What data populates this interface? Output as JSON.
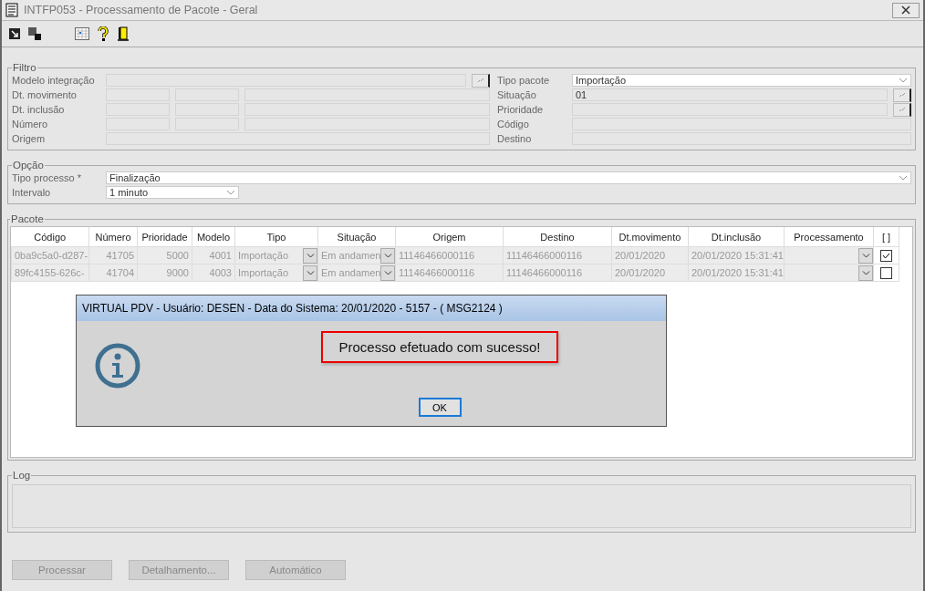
{
  "window": {
    "title": "INTFP053 - Processamento de Pacote - Geral"
  },
  "filtro": {
    "title": "Filtro",
    "left": [
      {
        "label": "Modelo integração",
        "kind": "lookup"
      },
      {
        "label": "Dt. movimento",
        "kind": "range"
      },
      {
        "label": "Dt. inclusão",
        "kind": "range"
      },
      {
        "label": "Número",
        "kind": "range"
      },
      {
        "label": "Origem",
        "kind": "text"
      }
    ],
    "right": [
      {
        "label": "Tipo pacote",
        "kind": "select",
        "value": "Importação"
      },
      {
        "label": "Situação",
        "kind": "lookup",
        "value": "01"
      },
      {
        "label": "Prioridade",
        "kind": "lookup"
      },
      {
        "label": "Código",
        "kind": "text"
      },
      {
        "label": "Destino",
        "kind": "text"
      }
    ]
  },
  "opcao": {
    "title": "Opção",
    "fields": [
      {
        "label": "Tipo processo *",
        "kind": "wide",
        "value": "Finalização"
      },
      {
        "label": "Intervalo",
        "kind": "short",
        "value": "1 minuto"
      }
    ]
  },
  "pacote": {
    "title": "Pacote",
    "columns": [
      "Código",
      "Número",
      "Prioridade",
      "Modelo",
      "Tipo",
      "Situação",
      "Origem",
      "Destino",
      "Dt.movimento",
      "Dt.inclusão",
      "Processamento",
      "[ ]"
    ],
    "rows": [
      {
        "codigo": "0ba9c5a0-d287-",
        "numero": "41705",
        "prioridade": "5000",
        "modelo": "4001",
        "tipo": "Importação",
        "situacao": "Em andamen",
        "origem": "11146466000116",
        "destino": "11146466000116",
        "dt_movimento": "20/01/2020",
        "dt_inclusao": "20/01/2020 15:31:41",
        "checked": true
      },
      {
        "codigo": "89fc4155-626c-",
        "numero": "41704",
        "prioridade": "9000",
        "modelo": "4003",
        "tipo": "Importação",
        "situacao": "Em andamen",
        "origem": "11146466000116",
        "destino": "11146466000116",
        "dt_movimento": "20/01/2020",
        "dt_inclusao": "20/01/2020 15:31:41",
        "checked": false
      }
    ]
  },
  "log": {
    "title": "Log"
  },
  "buttons": [
    {
      "label": "Processar",
      "disabled": true
    },
    {
      "label": "Detalhamento...",
      "disabled": true
    },
    {
      "label": "Automático",
      "disabled": true
    }
  ],
  "dialog": {
    "title": "VIRTUAL PDV - Usuário: DESEN - Data do Sistema: 20/01/2020 - 5157 - ( MSG2124 )",
    "message": "Processo efetuado com sucesso!",
    "button": "OK"
  }
}
